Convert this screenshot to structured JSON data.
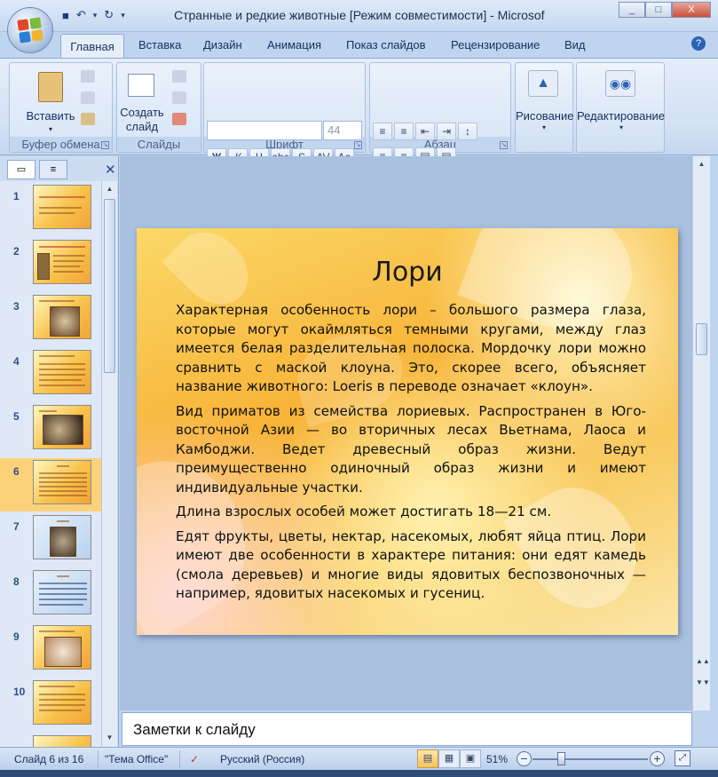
{
  "window": {
    "title": "Странные и редкие животные [Режим совместимости] - Microsof",
    "minimize": "_",
    "maximize": "□",
    "close": "X"
  },
  "tabs": [
    {
      "label": "Главная",
      "active": true
    },
    {
      "label": "Вставка"
    },
    {
      "label": "Дизайн"
    },
    {
      "label": "Анимация"
    },
    {
      "label": "Показ слайдов"
    },
    {
      "label": "Рецензирование"
    },
    {
      "label": "Вид"
    }
  ],
  "ribbon": {
    "clipboard": {
      "label": "Буфер обмена",
      "paste": "Вставить"
    },
    "slides": {
      "label": "Слайды",
      "new_slide_1": "Создать",
      "new_slide_2": "слайд"
    },
    "font": {
      "label": "Шрифт",
      "size": "44"
    },
    "paragraph": {
      "label": "Абзац"
    },
    "drawing": {
      "label": "Рисование"
    },
    "editing": {
      "label": "Редактирование"
    }
  },
  "slides_pane": {
    "thumbnails": [
      {
        "num": "1"
      },
      {
        "num": "2"
      },
      {
        "num": "3"
      },
      {
        "num": "4"
      },
      {
        "num": "5"
      },
      {
        "num": "6",
        "selected": true
      },
      {
        "num": "7"
      },
      {
        "num": "8"
      },
      {
        "num": "9"
      },
      {
        "num": "10"
      }
    ]
  },
  "slide": {
    "title": "Лори",
    "paragraphs": [
      "Характерная особенность лори – большого размера глаза, которые могут окаймляться темными кругами, между глаз имеется белая разделительная полоска. Мордочку лори можно сравнить с маской клоуна. Это, скорее всего, объясняет название животного: Loeris в переводе означает «клоун».",
      "Вид приматов из семейства лориевых. Распространен в Юго-восточной Азии — во вторичных лесах Вьетнама, Лаоса и Камбоджи. Ведет древесный образ жизни. Ведут преимущественно одиночный образ жизни и имеют индивидуальные участки.",
      "Длина взрослых особей может достигать 18—21 см.",
      "Едят фрукты, цветы, нектар, насекомых, любят яйца птиц. Лори имеют две особенности в характере питания: они едят камедь (смола деревьев) и многие виды ядовитых беспозвоночных — например, ядовитых насекомых и гусениц."
    ]
  },
  "notes": {
    "placeholder": "Заметки к слайду"
  },
  "status": {
    "slide_info": "Слайд 6 из 16",
    "theme": "\"Тема Office\"",
    "language": "Русский (Россия)",
    "zoom": "51%",
    "zoom_minus": "−",
    "zoom_plus": "+"
  },
  "colors": {
    "ribbon_bg": "#d3e1f4",
    "accent_selected": "#fbd27a",
    "slide_base": "#f7b337"
  }
}
